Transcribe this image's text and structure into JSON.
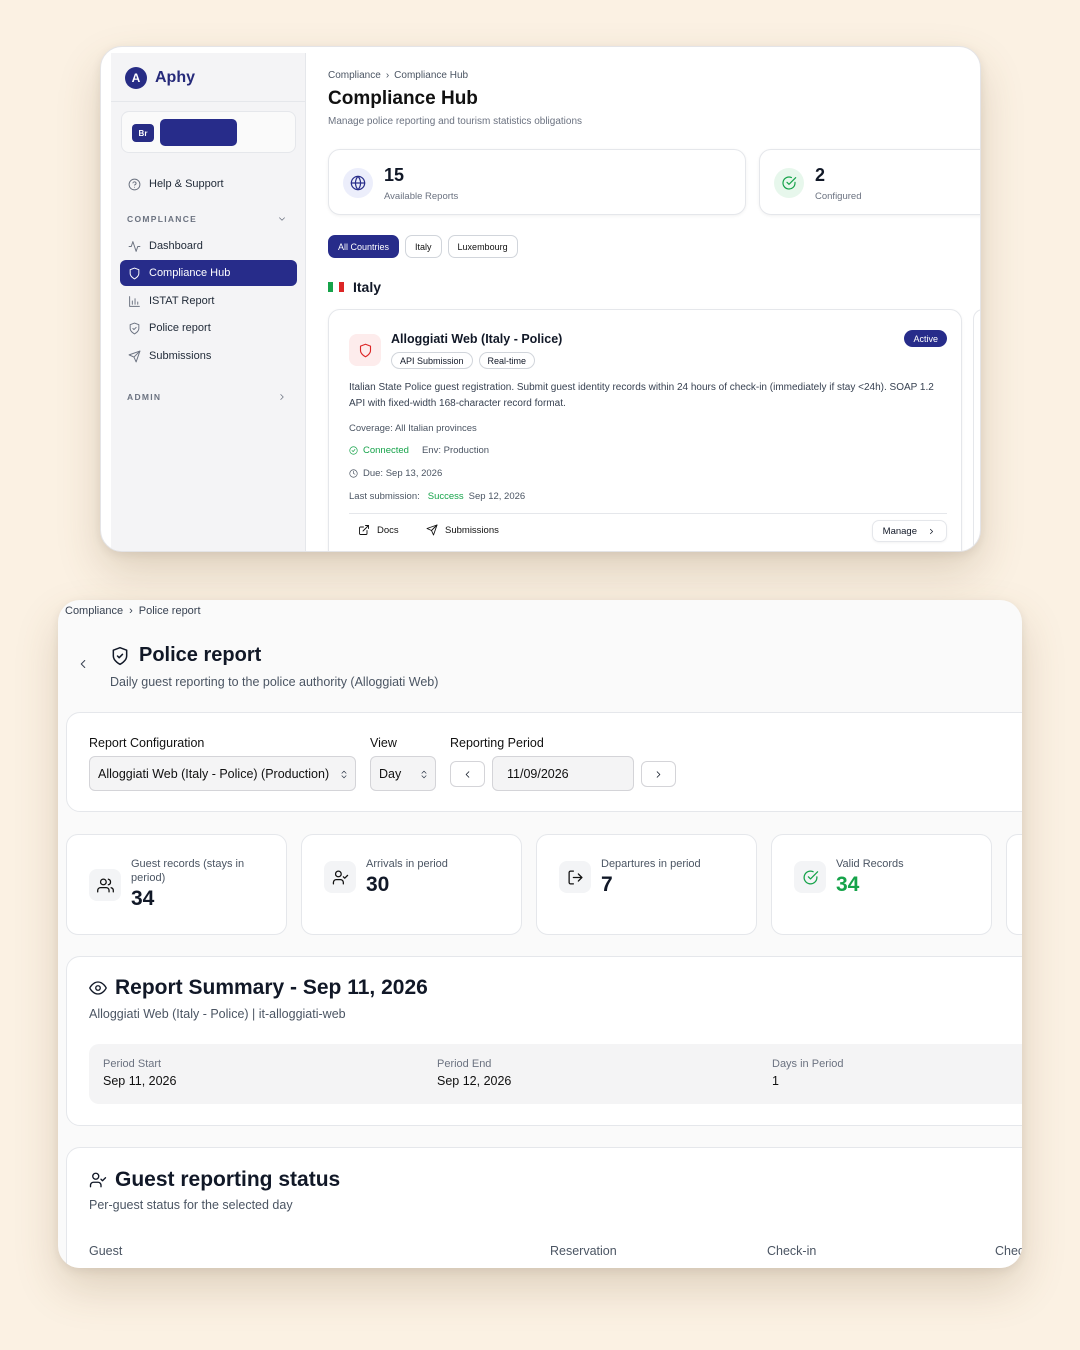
{
  "hub": {
    "brand": {
      "logo_letter": "A",
      "name": "Aphy"
    },
    "org": {
      "initials": "Br"
    },
    "sidebar": {
      "help": "Help & Support",
      "section_compliance": "COMPLIANCE",
      "items": [
        {
          "label": "Dashboard",
          "icon": "activity-icon"
        },
        {
          "label": "Compliance Hub",
          "icon": "shield-icon",
          "active": true
        },
        {
          "label": "ISTAT Report",
          "icon": "bar-chart-icon"
        },
        {
          "label": "Police report",
          "icon": "shield-check-icon"
        },
        {
          "label": "Submissions",
          "icon": "send-icon"
        }
      ],
      "section_admin": "ADMIN"
    },
    "breadcrumb": [
      "Compliance",
      "Compliance Hub"
    ],
    "title": "Compliance Hub",
    "subtitle": "Manage police reporting and tourism statistics obligations",
    "stats": [
      {
        "value": "15",
        "label": "Available Reports",
        "icon": "globe-icon"
      },
      {
        "value": "2",
        "label": "Configured",
        "icon": "check-circle-icon"
      }
    ],
    "filters": [
      "All Countries",
      "Italy",
      "Luxembourg"
    ],
    "selected_filter": "All Countries",
    "country": {
      "name": "Italy",
      "flag_colors": [
        "#16a34a",
        "#ffffff",
        "#dc2626"
      ]
    },
    "card": {
      "title": "Alloggiati Web (Italy - Police)",
      "tags": [
        "API Submission",
        "Real-time"
      ],
      "status": "Active",
      "description": "Italian State Police guest registration. Submit guest identity records within 24 hours of check-in (immediately if stay <24h). SOAP 1.2 API with fixed-width 168-character record format.",
      "coverage": "Coverage: All Italian provinces",
      "connection": "Connected",
      "env": "Env: Production",
      "due": "Due: Sep 13, 2026",
      "last_submission_label": "Last submission:",
      "last_submission_status": "Success",
      "last_submission_date": "Sep 12, 2026",
      "actions": {
        "docs": "Docs",
        "submissions": "Submissions",
        "manage": "Manage"
      }
    }
  },
  "police": {
    "breadcrumb": [
      "Compliance",
      "Police report"
    ],
    "title": "Police report",
    "subtitle": "Daily guest reporting to the police authority (Alloggiati Web)",
    "config": {
      "report_label": "Report Configuration",
      "report_value": "Alloggiati Web (Italy - Police) (Production)",
      "view_label": "View",
      "view_value": "Day",
      "period_label": "Reporting Period",
      "period_value": "11/09/2026"
    },
    "stats": [
      {
        "label": "Guest records (stays in period)",
        "value": "34",
        "icon": "users-icon"
      },
      {
        "label": "Arrivals in period",
        "value": "30",
        "icon": "user-check-icon"
      },
      {
        "label": "Departures in period",
        "value": "7",
        "icon": "log-out-icon"
      },
      {
        "label": "Valid Records",
        "value": "34",
        "icon": "check-circle-icon",
        "color": "#16a34a"
      }
    ],
    "summary": {
      "title": "Report Summary - Sep 11, 2026",
      "subtitle": "Alloggiati Web (Italy - Police) | it-alloggiati-web",
      "period_start_label": "Period Start",
      "period_start": "Sep 11, 2026",
      "period_end_label": "Period End",
      "period_end": "Sep 12, 2026",
      "days_label": "Days in Period",
      "days": "1"
    },
    "guest_status": {
      "title": "Guest reporting status",
      "subtitle": "Per-guest status for the selected day",
      "columns": [
        "Guest",
        "Reservation",
        "Check-in",
        "Chec"
      ]
    }
  }
}
